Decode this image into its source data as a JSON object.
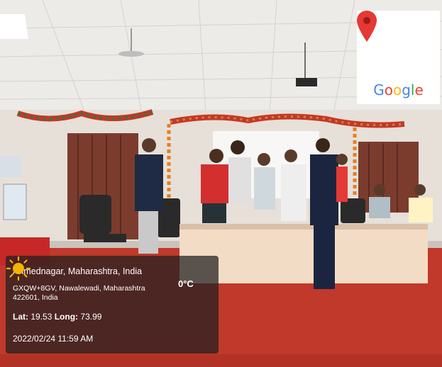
{
  "photo": {
    "description_icon": "photo-scene",
    "colors": {
      "wall": "#e9e3dc",
      "ceiling": "#f2f2f0",
      "stage": "#c0392b",
      "curtain": "#7a3a2c",
      "table_cloth": "#f5e2cf"
    }
  },
  "map_badge": {
    "pin_icon": "map-pin-icon",
    "pin_color": "#e53935",
    "logo_letters": [
      {
        "ch": "G",
        "color": "#4285F4"
      },
      {
        "ch": "o",
        "color": "#EA4335"
      },
      {
        "ch": "o",
        "color": "#FBBC05"
      },
      {
        "ch": "g",
        "color": "#4285F4"
      },
      {
        "ch": "l",
        "color": "#34A853"
      },
      {
        "ch": "e",
        "color": "#EA4335"
      }
    ]
  },
  "location": {
    "city": "Ahmednagar, Maharashtra, India",
    "address_line1": "GXQW+8GV, Nawalewadi, Maharashtra",
    "address_line2": "422601, India",
    "temperature": "0°C",
    "lat_label": "Lat:",
    "lat_value": "19.53",
    "long_label": "Long:",
    "long_value": "73.99",
    "datetime": "2022/02/24 11:59 AM",
    "weather_icon": "sun-icon",
    "sun_color": "#f5b400"
  }
}
